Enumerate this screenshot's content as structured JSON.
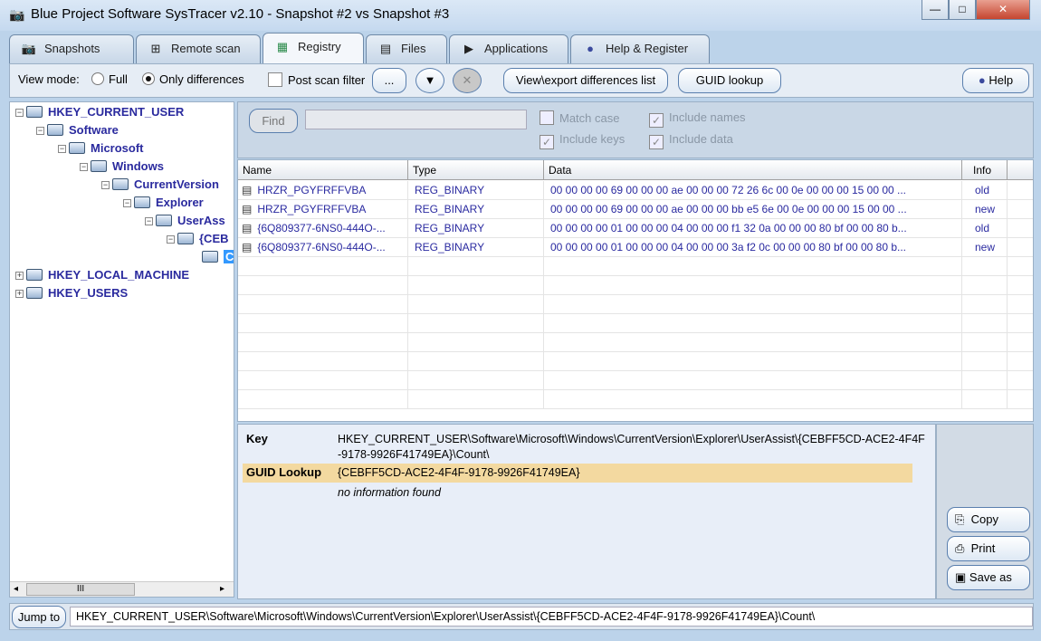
{
  "window": {
    "title": "Blue Project Software SysTracer v2.10 - Snapshot #2 vs Snapshot #3",
    "controls": [
      "minimize",
      "maximize",
      "close"
    ]
  },
  "tabs": [
    {
      "label": "Snapshots",
      "icon": "camera-icon"
    },
    {
      "label": "Remote scan",
      "icon": "network-icon"
    },
    {
      "label": "Registry",
      "icon": "registry-icon",
      "active": true
    },
    {
      "label": "Files",
      "icon": "file-icon"
    },
    {
      "label": "Applications",
      "icon": "applications-icon"
    },
    {
      "label": "Help & Register",
      "icon": "help-icon"
    }
  ],
  "toolbar": {
    "view_mode_label": "View mode:",
    "full_label": "Full",
    "only_diff_label": "Only differences",
    "view_mode_selected": "Only differences",
    "post_scan_filter_label": "Post scan filter",
    "post_scan_filter_checked": false,
    "ellipsis_label": "...",
    "view_export_label": "View\\export differences list",
    "guid_lookup_label": "GUID lookup",
    "help_label": "Help"
  },
  "tree": {
    "nodes": [
      {
        "label": "HKEY_CURRENT_USER",
        "expander": "−"
      },
      {
        "label": "Software",
        "expander": "−"
      },
      {
        "label": "Microsoft",
        "expander": "−"
      },
      {
        "label": "Windows",
        "expander": "−"
      },
      {
        "label": "CurrentVersion",
        "expander": "−"
      },
      {
        "label": "Explorer",
        "expander": "−"
      },
      {
        "label": "UserAss",
        "expander": "−"
      },
      {
        "label": "{CEB",
        "expander": "−"
      },
      {
        "label": "C",
        "expander": "",
        "selected": true
      },
      {
        "label": "HKEY_LOCAL_MACHINE",
        "expander": "+"
      },
      {
        "label": "HKEY_USERS",
        "expander": "+"
      }
    ],
    "scroll_label": "III"
  },
  "find": {
    "button_label": "Find",
    "input_value": "",
    "match_case": "Match case",
    "include_names": "Include names",
    "include_keys": "Include keys",
    "include_data": "Include data"
  },
  "table": {
    "columns": [
      "Name",
      "Type",
      "Data",
      "Info"
    ],
    "rows": [
      {
        "name": "HRZR_PGYFRFFVBA",
        "type": "REG_BINARY",
        "data": "00 00 00 00 69 00 00 00 ae 00 00 00 72 26 6c 00 0e 00 00 00 15 00 00 ...",
        "info": "old"
      },
      {
        "name": "HRZR_PGYFRFFVBA",
        "type": "REG_BINARY",
        "data": "00 00 00 00 69 00 00 00 ae 00 00 00 bb e5 6e 00 0e 00 00 00 15 00 00 ...",
        "info": "new"
      },
      {
        "name": "{6Q809377-6NS0-444O-...",
        "type": "REG_BINARY",
        "data": "00 00 00 00 01 00 00 00 04 00 00 00 f1 32 0a 00 00 00 80 bf 00 00 80 b...",
        "info": "old"
      },
      {
        "name": "{6Q809377-6NS0-444O-...",
        "type": "REG_BINARY",
        "data": "00 00 00 00 01 00 00 00 04 00 00 00 3a f2 0c 00 00 00 80 bf 00 00 80 b...",
        "info": "new"
      }
    ]
  },
  "detail": {
    "key_label": "Key",
    "key_value": "HKEY_CURRENT_USER\\Software\\Microsoft\\Windows\\CurrentVersion\\Explorer\\UserAssist\\{CEBFF5CD-ACE2-4F4F-9178-9926F41749EA}\\Count\\",
    "guid_label": "GUID Lookup",
    "guid_value": "{CEBFF5CD-ACE2-4F4F-9178-9926F41749EA}",
    "guid_info": "no information found",
    "highlight_color": "#f3d9a0"
  },
  "actions": {
    "copy": "Copy",
    "print": "Print",
    "save_as": "Save as"
  },
  "bottom": {
    "jump_label": "Jump to",
    "path": "HKEY_CURRENT_USER\\Software\\Microsoft\\Windows\\CurrentVersion\\Explorer\\UserAssist\\{CEBFF5CD-ACE2-4F4F-9178-9926F41749EA}\\Count\\"
  }
}
